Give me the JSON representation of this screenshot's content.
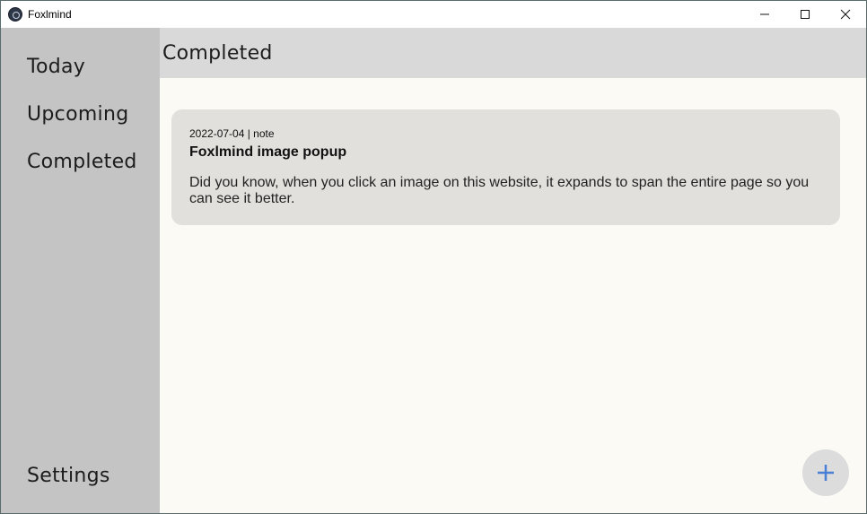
{
  "window": {
    "title": "Foxlmind",
    "icon": "app-logo-icon",
    "controls": [
      "minimize-icon",
      "maximize-icon",
      "close-icon"
    ]
  },
  "sidebar": {
    "items": [
      {
        "label": "Today"
      },
      {
        "label": "Upcoming"
      },
      {
        "label": "Completed"
      }
    ],
    "settings_label": "Settings"
  },
  "header": {
    "title": "Completed"
  },
  "notes": [
    {
      "meta": "2022-07-04 | note",
      "title": "Foxlmind image popup",
      "body": "Did you know, when you click an image on this website, it expands to span the entire page so you can see it better."
    }
  ],
  "fab": {
    "icon": "plus-icon",
    "color": "#4a7fd6"
  },
  "colors": {
    "sidebar_bg": "#c4c4c4",
    "header_bg": "#d9d9d9",
    "main_bg": "#fbfaf5",
    "card_bg": "#e2e0dc",
    "accent": "#4a7fd6"
  }
}
